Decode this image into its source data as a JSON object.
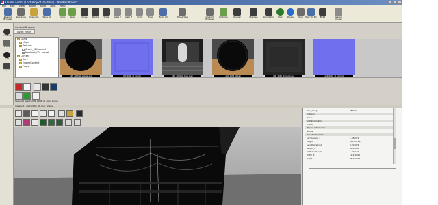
{
  "window": {
    "title": "Unreal Editor [Lost Project 2 Editor] - WinMainProject"
  },
  "menu": [
    "File",
    "Edit",
    "View",
    "Brush",
    "Build",
    "Tools",
    "Help"
  ],
  "toolbar": {
    "items": [
      {
        "label": "Restore Browser",
        "icon": "restore-icon"
      },
      {
        "label": "New Save",
        "icon": "new-icon"
      },
      {
        "label": "Open File",
        "icon": "open-icon"
      },
      {
        "label": "Save All",
        "icon": "save-icon"
      },
      {
        "label": "Undo",
        "icon": "undo-icon"
      },
      {
        "label": "Redo",
        "icon": "redo-icon"
      },
      {
        "label": "Move",
        "icon": "move-icon"
      },
      {
        "label": "Rotate",
        "icon": "rotate-icon"
      },
      {
        "label": "Scale",
        "icon": "scale-icon"
      },
      {
        "label": "Scale Y",
        "icon": "scale-y-icon"
      },
      {
        "label": "Scale Z",
        "icon": "scale-z-icon"
      },
      {
        "label": "Grid",
        "icon": "grid-icon"
      },
      {
        "label": "Snap",
        "icon": "snap-icon"
      },
      {
        "label": "Build All",
        "icon": "build-icon"
      },
      {
        "label": "Properties",
        "icon": "properties-icon"
      },
      {
        "label": "Content Browser",
        "icon": "content-browser-icon"
      },
      {
        "label": "Lighting",
        "icon": "lighting-icon"
      },
      {
        "label": "Kismet",
        "icon": "kismet-icon"
      },
      {
        "label": "Matinee",
        "icon": "matinee-icon"
      },
      {
        "label": "Simulation",
        "icon": "simulation-icon"
      },
      {
        "label": "Play",
        "icon": "play-icon"
      },
      {
        "label": "Pause",
        "icon": "pause-icon"
      },
      {
        "label": "Stop",
        "icon": "stop-icon"
      },
      {
        "label": "Play On PC",
        "icon": "play-on-pc-icon"
      },
      {
        "label": "Build",
        "icon": "build-2-icon"
      },
      {
        "label": "Game Mode",
        "icon": "game-mode-icon"
      }
    ]
  },
  "leftstrip": [
    "Content",
    "Scene",
    "Add",
    "Layers"
  ],
  "content_browser": {
    "header": "Content Browser",
    "tab": "Asset Views",
    "tree": [
      "Game",
      "Maps",
      "Textures",
      "Scene_001.uasset",
      "NewPack_001.uasset",
      "Content",
      "Core",
      "EngineContent",
      "Props"
    ],
    "thumbnails": [
      {
        "caption": "ASN_2008_at_sphere_emit",
        "color_top": "#444444",
        "color_bottom": "#b98b52"
      },
      {
        "caption": "ASN_2008_at_normal",
        "color_top": "#6c6ce8",
        "color_bottom": "#6c6ce8"
      },
      {
        "caption": "ASN_2008_at_door_open",
        "color_top": "#2a2a2a",
        "color_bottom": "#6f6f6f"
      },
      {
        "caption": "ASN_2008_at_ball",
        "color_top": "#3a3a3a",
        "color_bottom": "#b98b52"
      },
      {
        "caption": "ASN_2008_at_roughness",
        "color_top": "#2c2c2c",
        "color_bottom": "#2c2c2c"
      },
      {
        "caption": "ASN_2008_at_normal2",
        "color_top": "#6c6ce8",
        "color_bottom": "#6c6ce8"
      }
    ]
  },
  "mid_strip_label": "Selected Asset: ASN_2008_at_door_shape",
  "viewport": {
    "title": "Viewport - ASN_2008_at_door_shape"
  },
  "properties": {
    "rows": [
      {
        "key": "Base_Image",
        "value": "ENTITY",
        "section": false
      },
      {
        "key": "Collision",
        "value": "",
        "section": true
      },
      {
        "key": "Bones",
        "value": "",
        "section": false
      },
      {
        "key": "LOD Information",
        "value": "",
        "section": true
      },
      {
        "key": "Prefab",
        "value": "",
        "section": false
      },
      {
        "key": "Physics Information",
        "value": "",
        "section": true
      },
      {
        "key": "Nanite",
        "value": "",
        "section": false
      },
      {
        "key": "Import Information",
        "value": "",
        "section": true
      },
      {
        "key": "pelYlocation_c",
        "value": "1.382021",
        "section": false
      },
      {
        "key": "Height",
        "value": "000.007943",
        "section": false
      },
      {
        "key": "LengthlocationX",
        "value": "0.203026",
        "section": false
      },
      {
        "key": "Length_Y",
        "value": "60.04098",
        "section": false
      },
      {
        "key": "widthlocation_h",
        "value": "1.303120",
        "section": false
      },
      {
        "key": "Width_Z",
        "value": "11.240000",
        "section": false
      },
      {
        "key": "Depth",
        "value": "76.030772",
        "section": false
      }
    ]
  }
}
